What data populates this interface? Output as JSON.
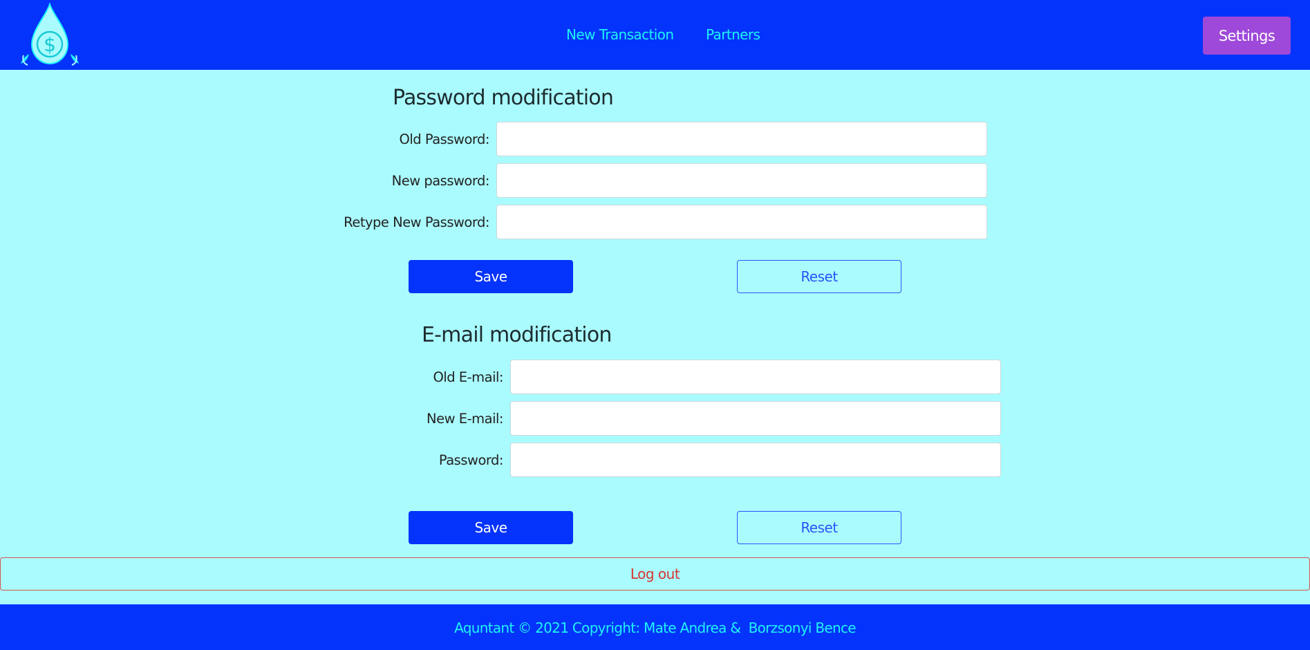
{
  "header": {
    "logo_icon": "water-drop-dollar-icon",
    "nav": [
      {
        "label": "New Transaction"
      },
      {
        "label": "Partners"
      }
    ],
    "settings_label": "Settings"
  },
  "password_section": {
    "title": "Password modification",
    "fields": [
      {
        "label": "Old Password:",
        "value": ""
      },
      {
        "label": "New password:",
        "value": ""
      },
      {
        "label": "Retype New Password:",
        "value": ""
      }
    ],
    "save_label": "Save",
    "reset_label": "Reset"
  },
  "email_section": {
    "title": "E-mail modification",
    "fields": [
      {
        "label": "Old E-mail:",
        "value": ""
      },
      {
        "label": "New E-mail:",
        "value": ""
      },
      {
        "label": "Password:",
        "value": ""
      }
    ],
    "save_label": "Save",
    "reset_label": "Reset"
  },
  "logout_label": "Log out",
  "footer": {
    "text": "Aquntant © 2021 Copyright: Mate Andrea &  Borzsonyi Bence"
  },
  "colors": {
    "brand_blue": "#0433fb",
    "page_bg": "#aafbfd",
    "nav_link": "#1ef3f7",
    "settings_purple": "#9e49d9",
    "logout_red": "#d9342f"
  }
}
